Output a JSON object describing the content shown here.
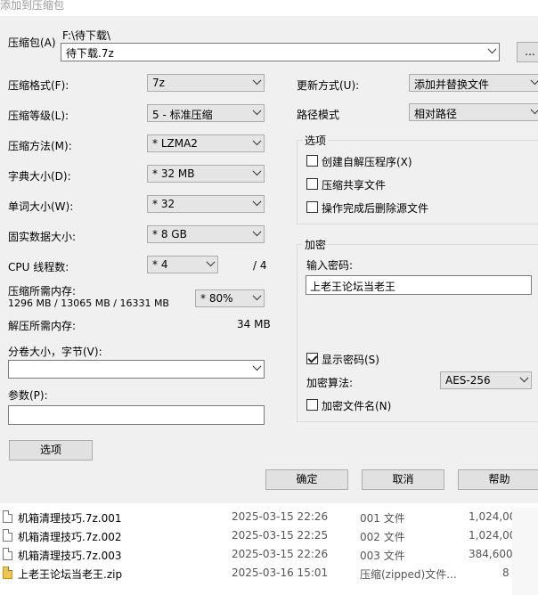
{
  "window": {
    "title": "添加到压缩包"
  },
  "archive": {
    "label": "压缩包(A)",
    "path_prefix": "F:\\待下载\\",
    "name": "待下载.7z",
    "browse_label": "..."
  },
  "left": {
    "format": {
      "label": "压缩格式(F):",
      "value": "7z"
    },
    "level": {
      "label": "压缩等级(L):",
      "value": "5 - 标准压缩"
    },
    "method": {
      "label": "压缩方法(M):",
      "value": "* LZMA2"
    },
    "dict": {
      "label": "字典大小(D):",
      "value": "* 32 MB"
    },
    "word": {
      "label": "单词大小(W):",
      "value": "* 32"
    },
    "solid": {
      "label": "固实数据大小:",
      "value": "* 8 GB"
    },
    "cpu": {
      "label": "CPU 线程数:",
      "value": "* 4",
      "max": "/ 4"
    },
    "mem": {
      "label": "压缩所需内存:",
      "detail": "1296 MB / 13065 MB / 16331 MB",
      "value": "* 80%"
    },
    "decomp": {
      "label": "解压所需内存:",
      "value": "34 MB"
    },
    "split": {
      "label": "分卷大小，字节(V):",
      "value": ""
    },
    "params": {
      "label": "参数(P):",
      "value": ""
    },
    "options_button": "选项"
  },
  "right": {
    "update": {
      "label": "更新方式(U):",
      "value": "添加并替换文件"
    },
    "pathmode": {
      "label": "路径模式",
      "value": "相对路径"
    },
    "options": {
      "title": "选项",
      "sfx": {
        "label": "创建自解压程序(X)",
        "checked": false
      },
      "shared": {
        "label": "压缩共享文件",
        "checked": false
      },
      "delete": {
        "label": "操作完成后删除源文件",
        "checked": false
      }
    },
    "encryption": {
      "title": "加密",
      "password_label": "输入密码:",
      "password": "上老王论坛当老王",
      "show_password": {
        "label": "显示密码(S)",
        "checked": true
      },
      "method_label": "加密算法:",
      "method": "AES-256",
      "encrypt_names": {
        "label": "加密文件名(N)",
        "checked": false
      }
    }
  },
  "buttons": {
    "ok": "确定",
    "cancel": "取消",
    "help": "帮助"
  },
  "files": [
    {
      "name": "机箱清理技巧.7z.001",
      "date": "2025-03-15 22:26",
      "type": "001 文件",
      "size": "1,024,00",
      "icon": "file-icon"
    },
    {
      "name": "机箱清理技巧.7z.002",
      "date": "2025-03-15 22:25",
      "type": "002 文件",
      "size": "1,024,00",
      "icon": "file-icon"
    },
    {
      "name": "机箱清理技巧.7z.003",
      "date": "2025-03-15 22:26",
      "type": "003 文件",
      "size": "384,600",
      "icon": "file-icon"
    },
    {
      "name": "上老王论坛当老王.zip",
      "date": "2025-03-16 15:01",
      "type": "压缩(zipped)文件...",
      "size": "8",
      "icon": "zip-folder-icon"
    }
  ]
}
